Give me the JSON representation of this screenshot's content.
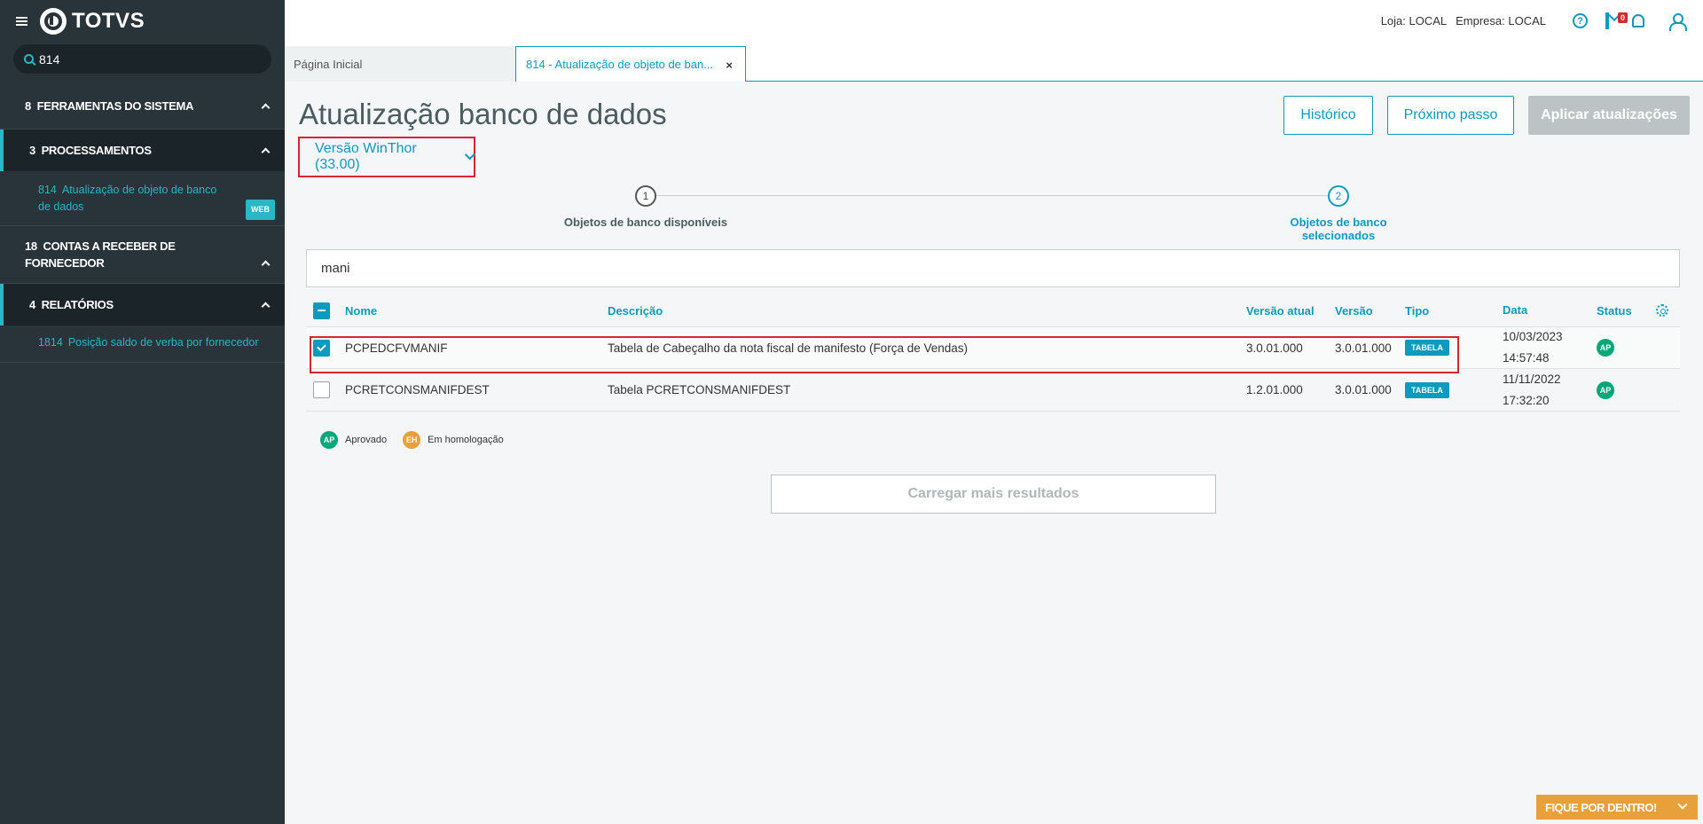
{
  "app": {
    "logo_text": "TOTVS"
  },
  "sidebar": {
    "search_value": "814",
    "groups": [
      {
        "num": "8",
        "label": "FERRAMENTAS DO SISTEMA"
      },
      {
        "num": "3",
        "label": "PROCESSAMENTOS",
        "sub": {
          "num": "814",
          "label": "Atualização de objeto de banco de dados",
          "badge": "WEB"
        }
      },
      {
        "num": "18",
        "label": "CONTAS A RECEBER DE FORNECEDOR"
      },
      {
        "num": "4",
        "label": "RELATÓRIOS",
        "sub": {
          "num": "1814",
          "label": "Posição saldo de verba por fornecedor"
        }
      }
    ]
  },
  "header": {
    "loja": "Loja: LOCAL",
    "empresa": "Empresa: LOCAL",
    "help_glyph": "?",
    "mail_count": "0"
  },
  "tabs": [
    {
      "label": "Página Inicial"
    },
    {
      "label": "814 - Atualização de objeto de ban...",
      "close": "×"
    }
  ],
  "page": {
    "title": "Atualização banco de dados",
    "version_label": "Versão WinThor (33.00)",
    "buttons": {
      "historico": "Histórico",
      "proximo": "Próximo passo",
      "aplicar": "Aplicar atualizações"
    },
    "steps": [
      {
        "num": "1",
        "label": "Objetos de banco disponíveis"
      },
      {
        "num": "2",
        "label": "Objetos de banco selecionados"
      }
    ],
    "filter_value": "mani"
  },
  "table": {
    "columns": [
      "Nome",
      "Descrição",
      "Versão atual",
      "Versão",
      "Tipo",
      "Data",
      "Status"
    ],
    "rows": [
      {
        "checked": true,
        "nome": "PCPEDCFVMANIF",
        "descricao": "Tabela de Cabeçalho da nota fiscal de manifesto (Força de Vendas)",
        "versao_atual": "3.0.01.000",
        "versao": "3.0.01.000",
        "tipo": "TABELA",
        "data": "10/03/2023",
        "hora": "14:57:48",
        "status": "AP"
      },
      {
        "checked": false,
        "nome": "PCRETCONSMANIFDEST",
        "descricao": "Tabela PCRETCONSMANIFDEST",
        "versao_atual": "1.2.01.000",
        "versao": "3.0.01.000",
        "tipo": "TABELA",
        "data": "11/11/2022",
        "hora": "17:32:20",
        "status": "AP"
      }
    ]
  },
  "legend": [
    {
      "code": "AP",
      "label": "Aprovado",
      "color": "#00a877"
    },
    {
      "code": "EH",
      "label": "Em homologação",
      "color": "#e8a03a"
    }
  ],
  "load_more": "Carregar mais resultados",
  "fique": "FIQUE POR DENTRO!",
  "colors": {
    "accent": "#0c9abe",
    "sidebar_bg": "#28333a",
    "highlight_red": "#d8262f",
    "approved": "#00a877",
    "orange": "#e8a03a"
  }
}
